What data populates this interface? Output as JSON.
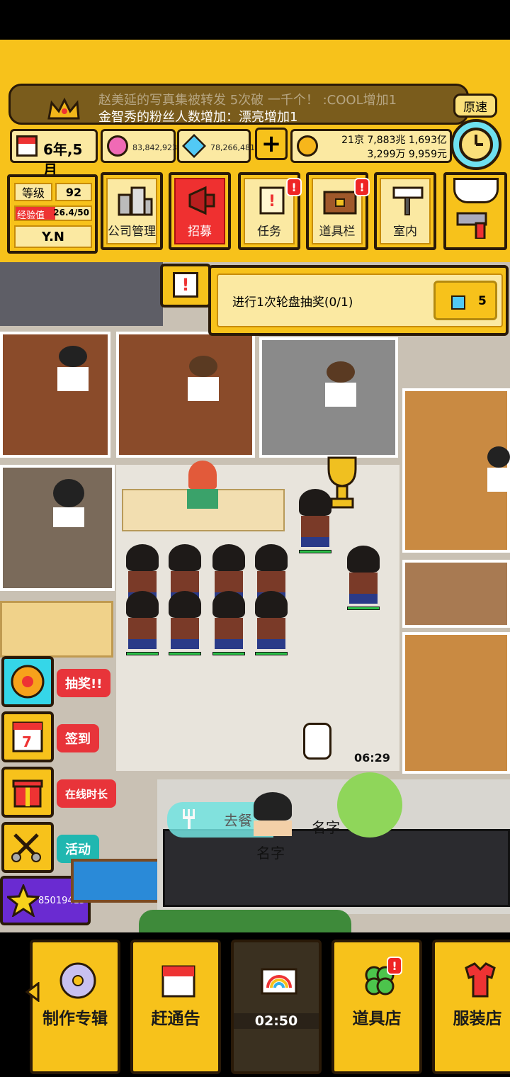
{
  "ticker": {
    "line1": "赵美延的写真集被转发 5次破 一千个！ :COOL增加1",
    "line2": "金智秀的粉丝人数增加：漂亮增加1"
  },
  "speed_button": "原速",
  "status": {
    "date": "6年,5月",
    "gems_pink": "83,842,923",
    "gems_blue": "78,266,481",
    "money_line1": "21京 7,883兆 1,693亿",
    "money_line2": "3,299万 9,959元"
  },
  "profile": {
    "level_label": "等级",
    "level": "92",
    "exp_label": "经验值",
    "exp": "26.4/50",
    "exp_fraction": 0.528,
    "name": "Y.N"
  },
  "menu": [
    {
      "label": "公司管理",
      "icon": "buildings-icon",
      "active": false,
      "badge": false
    },
    {
      "label": "招募",
      "icon": "megaphone-icon",
      "active": true,
      "badge": false
    },
    {
      "label": "任务",
      "icon": "scroll-icon",
      "active": false,
      "badge": true
    },
    {
      "label": "道具栏",
      "icon": "chest-icon",
      "active": false,
      "badge": true
    },
    {
      "label": "室内",
      "icon": "paint-roller-icon",
      "active": false,
      "badge": false
    }
  ],
  "quest": {
    "text": "进行1次轮盘抽奖(0/1)",
    "reward": "5"
  },
  "side_buttons": [
    {
      "label": "抽奖!!",
      "icon": "roulette-icon",
      "color": "#e8343a"
    },
    {
      "label": "签到",
      "icon": "calendar-icon",
      "color": "#e8343a"
    },
    {
      "label": "在线时长",
      "icon": "gift-icon",
      "color": "#e8343a"
    },
    {
      "label": "活动",
      "icon": "scissors-icon",
      "color": "#20b7b0"
    }
  ],
  "star_counter": "85019415",
  "scene": {
    "timer": "06:29",
    "go_eat": "去餐",
    "name_tag1": "名字",
    "name_tag2": "名字"
  },
  "bottom_nav": [
    {
      "label": "制作专辑",
      "icon": "cd-icon"
    },
    {
      "label": "赶通告",
      "icon": "schedule-icon"
    },
    {
      "label": "02:50",
      "icon": "rainbow-icon"
    },
    {
      "label": "道具店",
      "icon": "clover-icon"
    },
    {
      "label": "服装店",
      "icon": "clothes-icon"
    }
  ],
  "colors": {
    "gold": "#f7c21b",
    "cream": "#fbe9a2",
    "outline": "#2a1a08",
    "red": "#ef2525",
    "teal": "#20b7b0",
    "purple": "#6a2bd1"
  }
}
